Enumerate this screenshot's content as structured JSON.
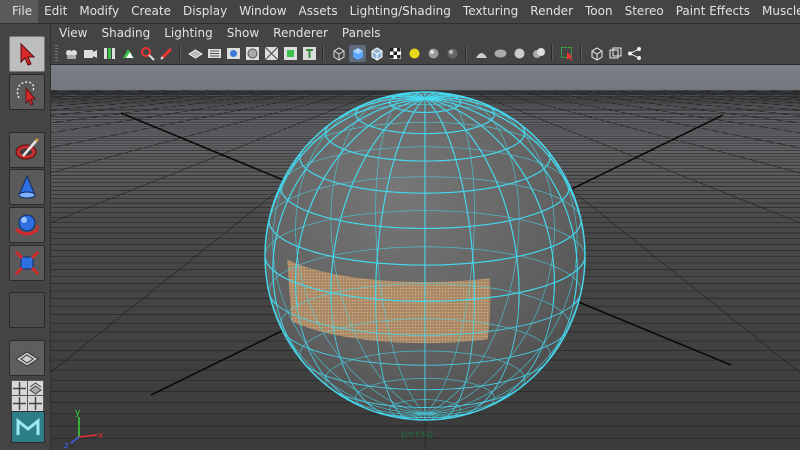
{
  "menubar": {
    "items": [
      "File",
      "Edit",
      "Modify",
      "Create",
      "Display",
      "Window",
      "Assets",
      "Lighting/Shading",
      "Texturing",
      "Render",
      "Toon",
      "Stereo",
      "Paint Effects",
      "Muscle"
    ]
  },
  "panel": {
    "menu": [
      "View",
      "Shading",
      "Lighting",
      "Show",
      "Renderer",
      "Panels"
    ],
    "view_name": "persp"
  },
  "toolbox": {
    "tools": [
      "select-tool",
      "lasso-tool",
      "paint-select-tool",
      "move-tool",
      "rotate-tool",
      "scale-tool"
    ],
    "active": "select-tool"
  },
  "panel_toolbar": {
    "icons": [
      "camera-select-icon",
      "camera-attributes-icon",
      "bookmarks-icon",
      "image-plane-icon",
      "2d-pan-zoom-icon",
      "grease-pencil-icon",
      "grid-icon",
      "film-gate-icon",
      "resolution-gate-icon",
      "gate-mask-icon",
      "field-chart-icon",
      "safe-action-icon",
      "safe-title-icon",
      "wireframe-icon",
      "smooth-shade-icon",
      "wireframe-on-shaded-icon",
      "textured-icon",
      "use-all-lights-icon",
      "shadows-icon",
      "screen-space-ao-icon",
      "motion-blur-icon",
      "multisample-aa-icon",
      "depth-of-field-icon",
      "isolate-select-icon",
      "xray-icon",
      "xray-active-components-icon",
      "xray-joints-icon"
    ]
  },
  "colors": {
    "wire": "#45d8ee",
    "sphere": "#676767",
    "selected_faces": "#c4a47a",
    "grid": "#1c1c1c",
    "viewport_bg_top": "#777d84",
    "viewport_bg_bottom": "#3b3b3b",
    "axis_x": "#e53131",
    "axis_y": "#37d43d",
    "axis_z": "#3e5ef0"
  },
  "axis": {
    "x": "x",
    "y": "y",
    "z": "z"
  }
}
